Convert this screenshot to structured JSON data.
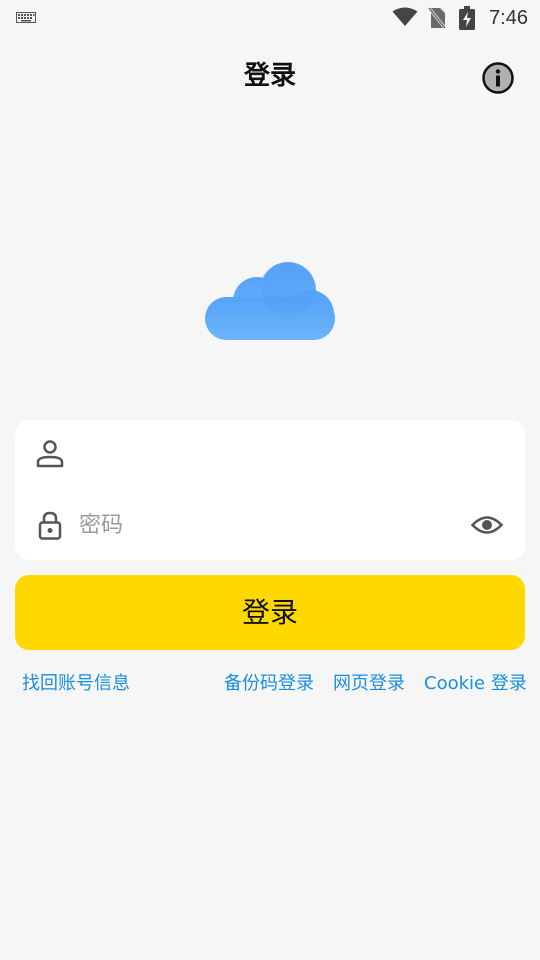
{
  "status_bar": {
    "time": "7:46",
    "icons": [
      "keyboard-icon",
      "wifi-icon",
      "no-sim-icon",
      "battery-charging-icon"
    ]
  },
  "app_bar": {
    "title": "登录",
    "info_icon": "info-icon"
  },
  "logo": {
    "icon": "cloud-logo-icon",
    "color": "#5aa8f8"
  },
  "form": {
    "username": {
      "icon": "user-icon",
      "value": "",
      "placeholder": ""
    },
    "password": {
      "icon": "lock-icon",
      "value": "",
      "placeholder": "密码",
      "visibility_icon": "eye-icon"
    }
  },
  "login_button": {
    "label": "登录",
    "color": "#ffd800"
  },
  "links": {
    "recover": "找回账号信息",
    "backup_code": "备份码登录",
    "web": "网页登录",
    "cookie": "Cookie 登录",
    "color": "#1a8fe0"
  }
}
